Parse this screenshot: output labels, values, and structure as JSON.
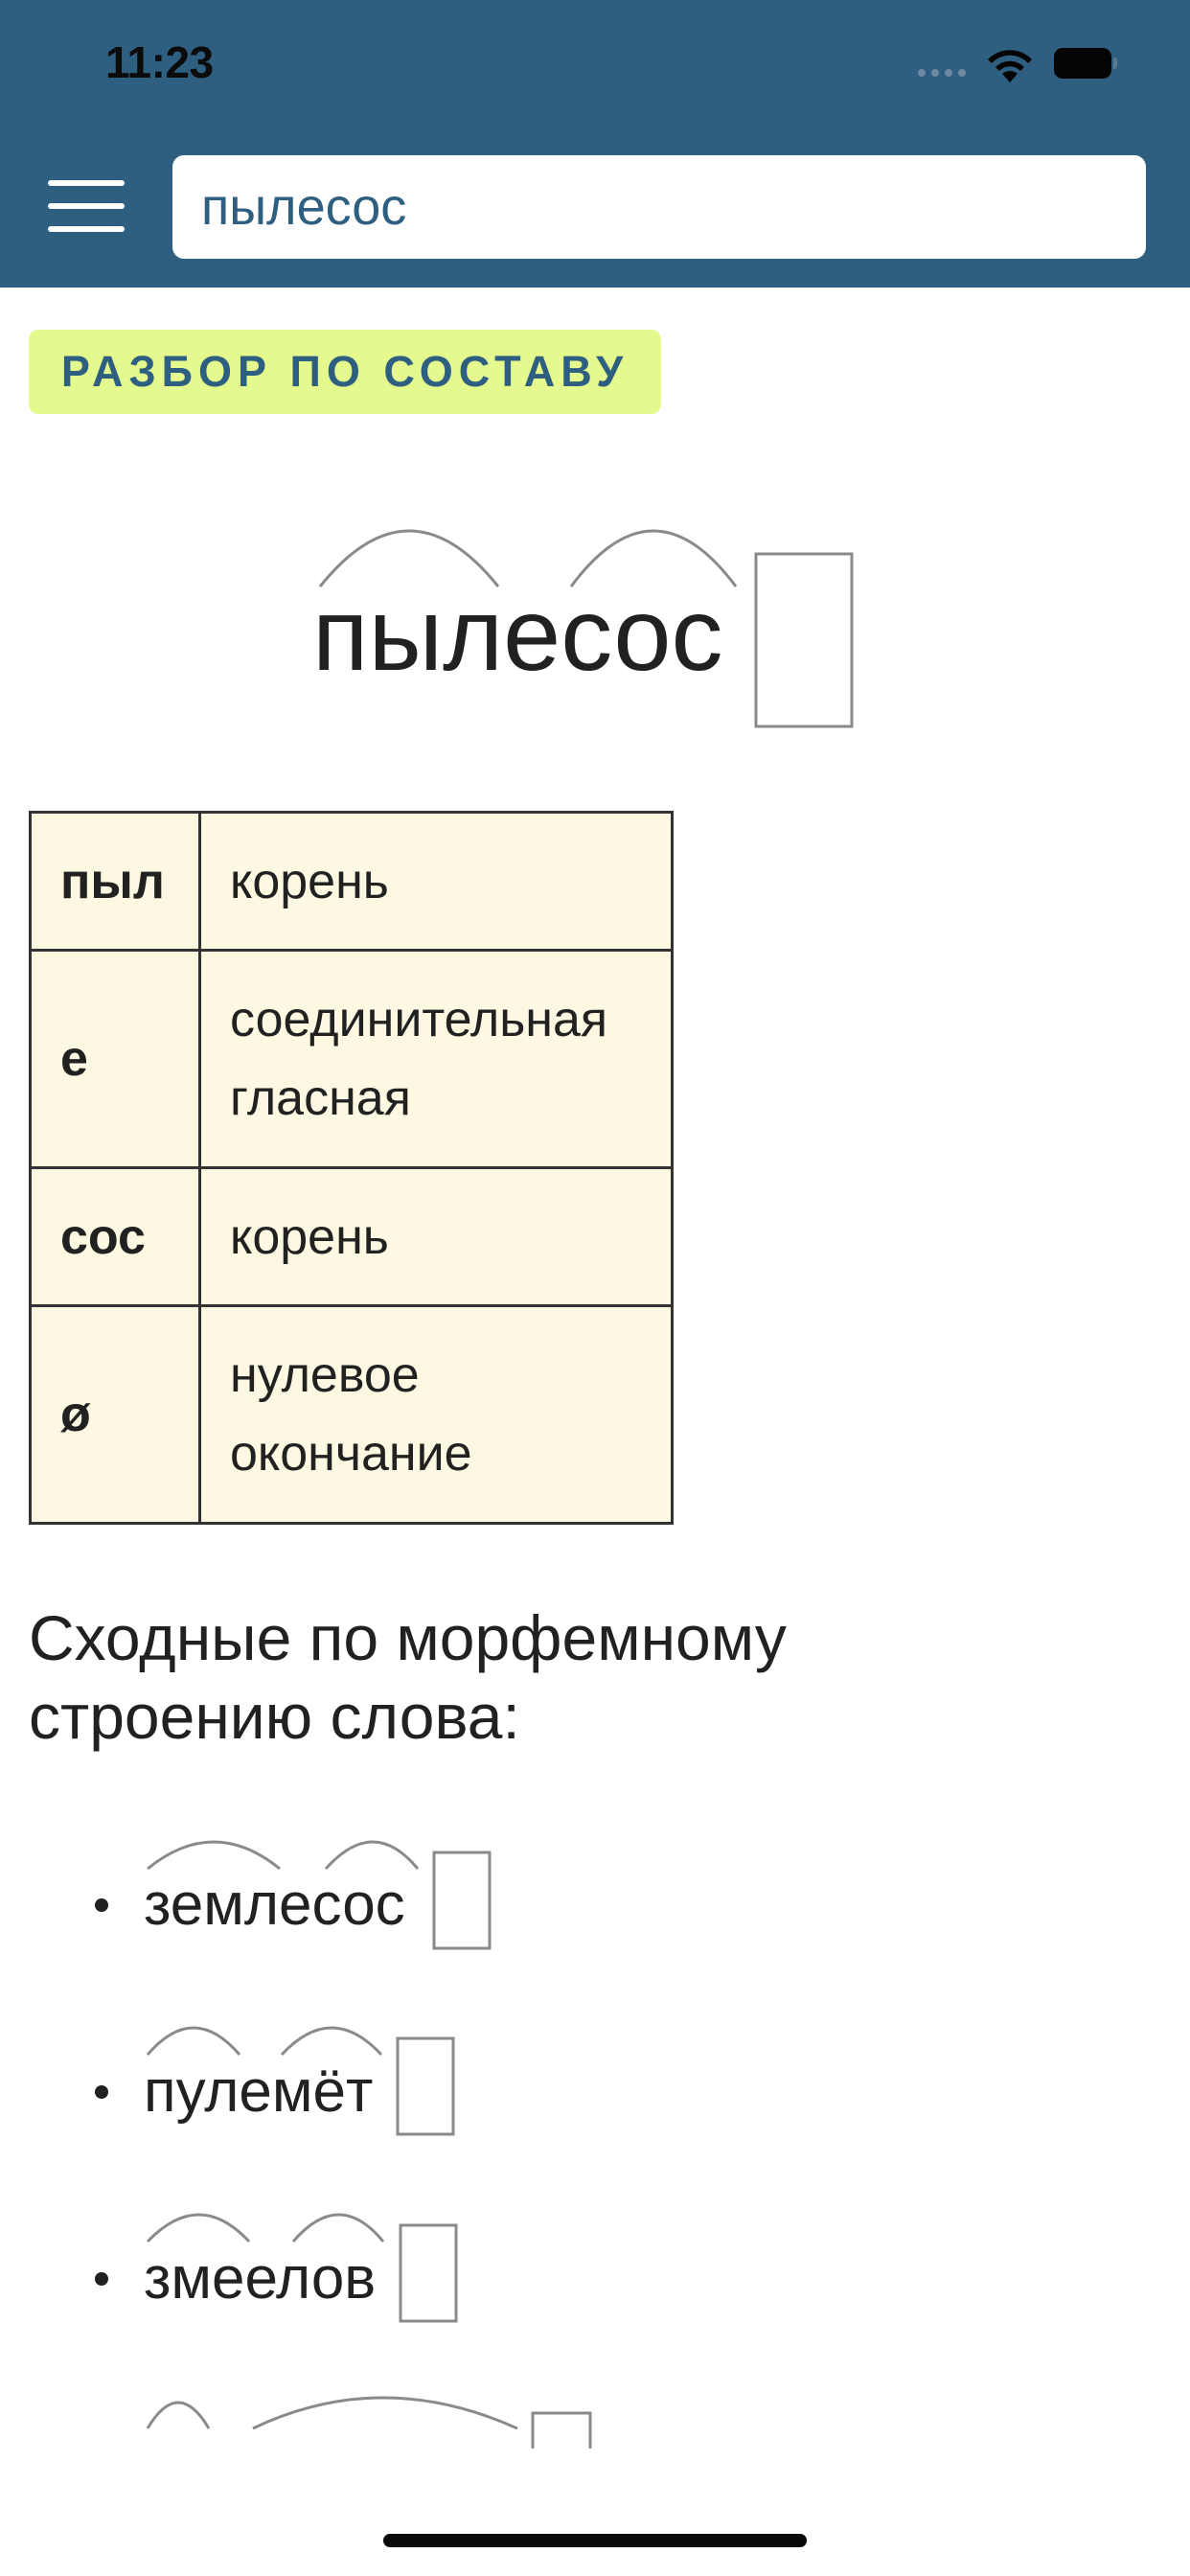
{
  "status_bar": {
    "time": "11:23",
    "icons": [
      "signal-icon",
      "wifi-icon",
      "battery-icon"
    ]
  },
  "header": {
    "menu_icon": "hamburger-menu-icon",
    "search_value": "пылесос",
    "background_color": "#2e5f80"
  },
  "badge": {
    "label": "РАЗБОР ПО СОСТАВУ",
    "background_color": "#e4f98e"
  },
  "main_word": {
    "text": "пылесос",
    "morphemes": [
      {
        "part": "пыл",
        "meaning": "корень"
      },
      {
        "part": "е",
        "meaning": "соединительная гласная"
      },
      {
        "part": "сос",
        "meaning": "корень"
      },
      {
        "part": "ø",
        "meaning": "нулевое окончание"
      }
    ]
  },
  "table": {
    "rows": [
      {
        "part": "пыл",
        "meaning": "корень"
      },
      {
        "part": "е",
        "meaning_line1": "соединительная",
        "meaning_line2": "гласная"
      },
      {
        "part": "сос",
        "meaning": "корень"
      },
      {
        "part": "ø",
        "meaning_line1": "нулевое",
        "meaning_line2": "окончание"
      }
    ]
  },
  "similar": {
    "title_line1": "Сходные по морфемному",
    "title_line2": "строению слова:",
    "words": [
      "землесос",
      "пулемёт",
      "змеелов"
    ]
  }
}
